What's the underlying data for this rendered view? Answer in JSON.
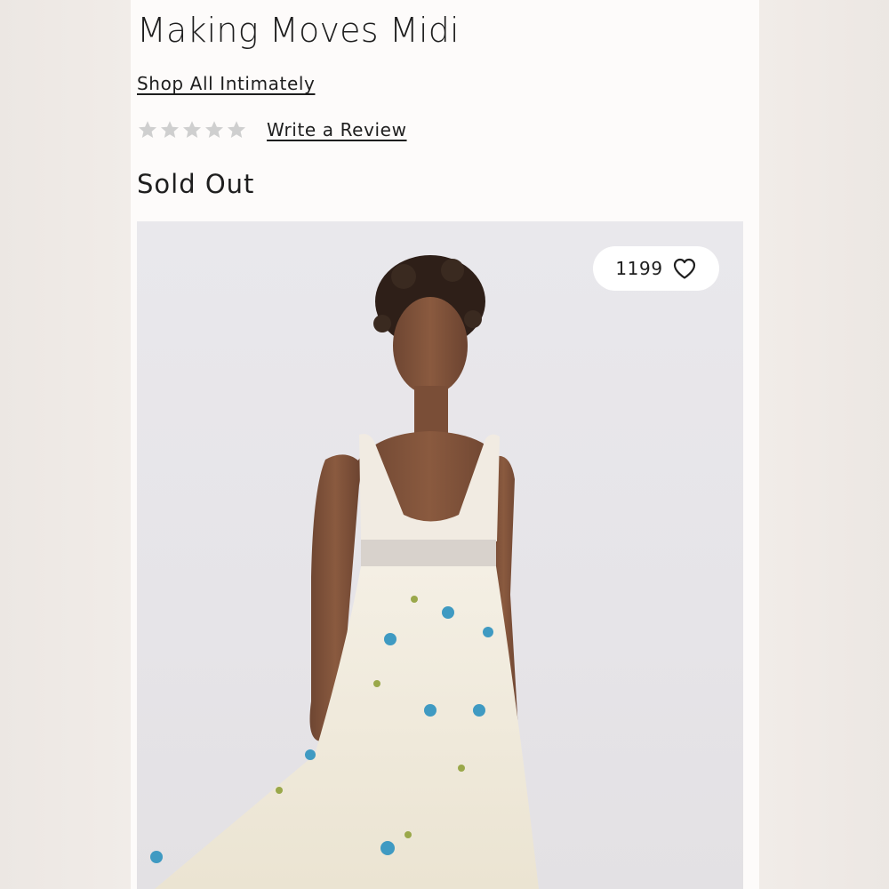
{
  "product": {
    "title": "Making Moves Midi",
    "shop_link": "Shop All Intimately",
    "review_link": "Write a Review",
    "status": "Sold Out",
    "rating": {
      "stars_total": 5,
      "stars_filled": 0,
      "star_color": "#cfcfcf"
    }
  },
  "image": {
    "favorite_count": "1199",
    "icon": "heart-outline-icon"
  },
  "colors": {
    "page_bg": "#fdfbfa",
    "side_bg": "#ece7e3",
    "text": "#1e1e1e",
    "image_bg": "#e8e6ea"
  }
}
